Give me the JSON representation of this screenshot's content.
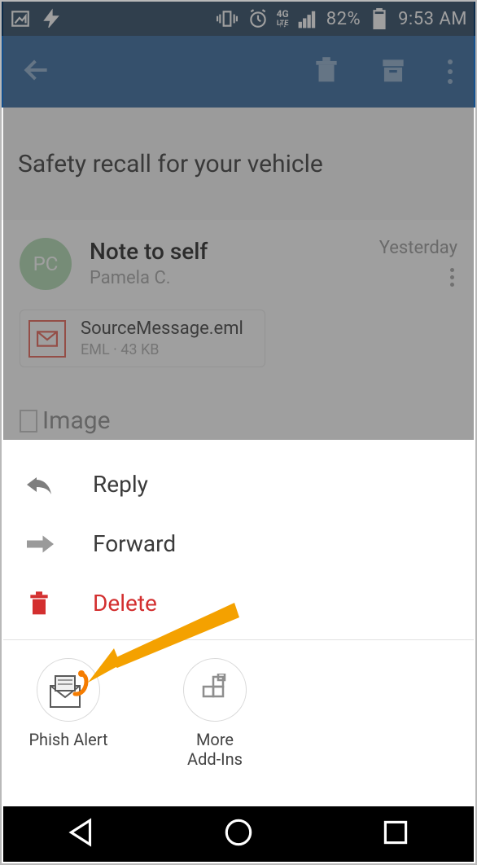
{
  "status": {
    "battery_pct": "82%",
    "time": "9:53 AM"
  },
  "subject": "Safety recall for your vehicle",
  "message": {
    "avatar_initials": "PC",
    "title": "Note to self",
    "from": "Pamela C.",
    "date": "Yesterday"
  },
  "attachment": {
    "filename": "SourceMessage.eml",
    "meta": "EML · 43 KB"
  },
  "image_placeholder_label": "Image",
  "menu": {
    "reply": "Reply",
    "forward": "Forward",
    "delete": "Delete"
  },
  "addins": {
    "phish": "Phish Alert",
    "more": "More\nAdd-Ins"
  }
}
